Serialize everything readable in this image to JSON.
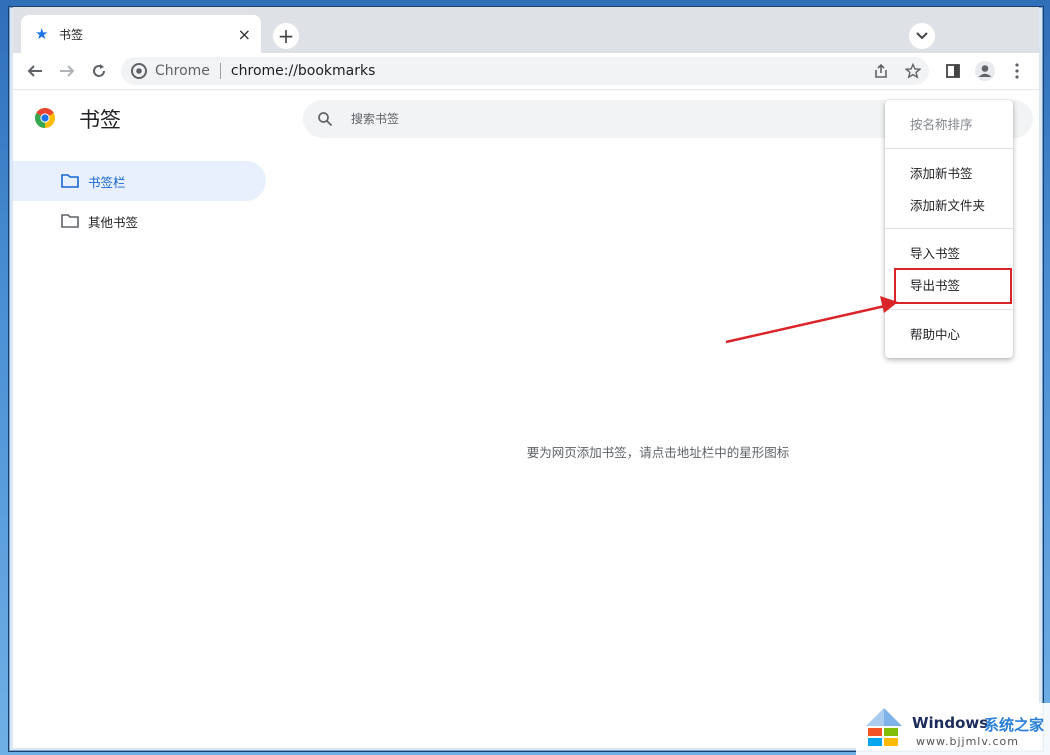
{
  "tab": {
    "title": "书签",
    "close_symbol": "×",
    "new_tab_symbol": "+"
  },
  "omnibox": {
    "origin": "Chrome",
    "url": "chrome://bookmarks"
  },
  "page": {
    "title": "书签",
    "search_placeholder": "搜索书签",
    "empty_message": "要为网页添加书签，请点击地址栏中的星形图标"
  },
  "sidebar": {
    "items": [
      {
        "label": "书签栏",
        "active": true
      },
      {
        "label": "其他书签",
        "active": false
      }
    ]
  },
  "menu": {
    "items": [
      {
        "label": "按名称排序",
        "disabled": true
      },
      {
        "label": "添加新书签"
      },
      {
        "label": "添加新文件夹"
      },
      {
        "label": "导入书签"
      },
      {
        "label": "导出书签",
        "highlighted": true
      },
      {
        "label": "帮助中心"
      }
    ]
  },
  "watermark": {
    "brand": "Windows",
    "suffix": "系统之家",
    "url": "www.bjjmlv.com"
  },
  "colors": {
    "accent": "#1a73e8",
    "highlight": "#d9252a",
    "active_bg": "#e8f0fe"
  },
  "icons": [
    "star-icon",
    "close-icon",
    "plus-icon",
    "chevron-down-icon",
    "back-arrow-icon",
    "forward-arrow-icon",
    "reload-icon",
    "chrome-logo-icon",
    "share-icon",
    "bookmark-star-icon",
    "side-panel-icon",
    "profile-icon",
    "more-vert-icon",
    "search-icon",
    "folder-icon"
  ]
}
